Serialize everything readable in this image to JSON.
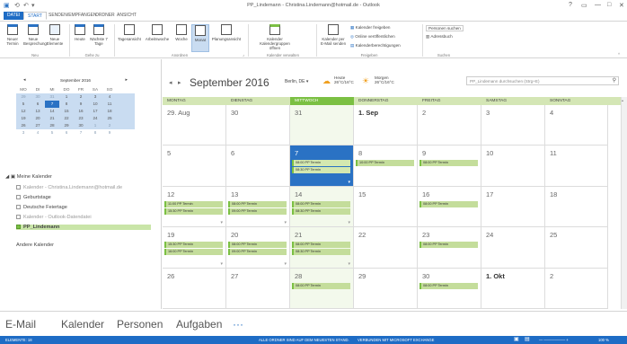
{
  "window": {
    "title": "PP_Lindemann - Christina.Lindemann@hotmail.de - Outlook",
    "help": "?",
    "minimize": "—",
    "maximize": "□",
    "close": "✕"
  },
  "ribbon_tabs": [
    "DATEI",
    "START",
    "SENDEN/EMPFANGEN",
    "ORDNER",
    "ANSICHT"
  ],
  "ribbon": {
    "new": {
      "neuer_termin": "Neuer Termin",
      "neue_besprechung": "Neue Besprechung",
      "neue_elemente": "Neue Elemente",
      "group": "Neu"
    },
    "goto": {
      "heute": "Heute",
      "naechste": "Nächste 7 Tage",
      "group": "Gehe zu"
    },
    "arrange": {
      "tagesansicht": "Tagesansicht",
      "arbeitswoche": "Arbeitswoche",
      "woche": "Woche",
      "monat": "Monat",
      "planung": "Planungsansicht",
      "group": "Anordnen"
    },
    "manage": {
      "kalendergruppen": "Kalender Kalendergruppen",
      "oeffnen": "öffnen",
      "group": "Kalender verwalten"
    },
    "share": {
      "email": "Kalender per E-Mail senden",
      "freigeben": "Kalender freigeben",
      "online": "Online veröffentlichen",
      "berechtigungen": "Kalenderberechtigungen",
      "group": "Freigeben"
    },
    "search": {
      "personen": "Personen suchen",
      "adressbuch": "Adressbuch",
      "group": "Suchen"
    }
  },
  "minical": {
    "title": "September 2016",
    "days": [
      "MO",
      "DI",
      "MI",
      "DO",
      "FR",
      "SA",
      "SO"
    ],
    "weeks": [
      [
        "29",
        "30",
        "31",
        "1",
        "2",
        "3",
        "4"
      ],
      [
        "5",
        "6",
        "7",
        "8",
        "9",
        "10",
        "11"
      ],
      [
        "12",
        "13",
        "14",
        "15",
        "16",
        "17",
        "18"
      ],
      [
        "19",
        "20",
        "21",
        "22",
        "23",
        "24",
        "25"
      ],
      [
        "26",
        "27",
        "28",
        "29",
        "30",
        "1",
        "2"
      ],
      [
        "3",
        "4",
        "5",
        "6",
        "7",
        "8",
        "9"
      ]
    ]
  },
  "calendars": {
    "group_title": "Meine Kalender",
    "items": [
      {
        "label": "Kalender - Christina.Lindemann@hotmail.de",
        "checked": false,
        "grey": true
      },
      {
        "label": "Geburtstage",
        "checked": false,
        "grey": false
      },
      {
        "label": "Deutsche Feiertage",
        "checked": false,
        "grey": false
      },
      {
        "label": "Kalender - Outlook-Datendatei",
        "checked": false,
        "grey": true
      },
      {
        "label": "PP_Lindemann",
        "checked": true,
        "grey": false
      }
    ],
    "other_title": "Andere Kalender"
  },
  "calendar": {
    "month_title": "September 2016",
    "weather_city": "Berlin, DE",
    "heute_label": "Heute",
    "heute_temp": "26°C/16°C",
    "morgen_label": "Morgen",
    "morgen_temp": "26°C/16°C",
    "search_placeholder": "PP_Lindemann durchsuchen (Strg+E)",
    "weekdays": [
      "MONTAG",
      "DIENSTAG",
      "MITTWOCH",
      "DONNERSTAG",
      "FREITAG",
      "SAMSTAG",
      "SONNTAG"
    ],
    "weeks": [
      [
        {
          "d": "29. Aug",
          "ev": []
        },
        {
          "d": "30",
          "ev": []
        },
        {
          "d": "31",
          "ev": []
        },
        {
          "d": "1. Sep",
          "bold": true,
          "ev": []
        },
        {
          "d": "2",
          "ev": []
        },
        {
          "d": "3",
          "ev": []
        },
        {
          "d": "4",
          "ev": []
        }
      ],
      [
        {
          "d": "5",
          "ev": []
        },
        {
          "d": "6",
          "ev": []
        },
        {
          "d": "7",
          "sel": true,
          "ev": [
            "08:00 PP Termin",
            "08:30 PP Termin"
          ]
        },
        {
          "d": "8",
          "ev": [
            "10:00 PP Termin"
          ]
        },
        {
          "d": "9",
          "ev": [
            "08:00 PP Termin"
          ]
        },
        {
          "d": "10",
          "ev": []
        },
        {
          "d": "11",
          "ev": []
        }
      ],
      [
        {
          "d": "12",
          "ev": [
            "11:00 PP Termin",
            "15:30 PP Termin"
          ],
          "more": true
        },
        {
          "d": "13",
          "ev": [
            "08:00 PP Termin",
            "09:00 PP Termin"
          ],
          "more": true
        },
        {
          "d": "14",
          "ev": [
            "08:00 PP Termin",
            "08:30 PP Termin"
          ],
          "more": true
        },
        {
          "d": "15",
          "ev": []
        },
        {
          "d": "16",
          "ev": [
            "08:00 PP Termin"
          ]
        },
        {
          "d": "17",
          "ev": []
        },
        {
          "d": "18",
          "ev": []
        }
      ],
      [
        {
          "d": "19",
          "ev": [
            "15:30 PP Termin",
            "16:00 PP Termin"
          ],
          "more": true
        },
        {
          "d": "20",
          "ev": [
            "08:00 PP Termin",
            "09:00 PP Termin"
          ],
          "more": true
        },
        {
          "d": "21",
          "ev": [
            "08:00 PP Termin",
            "08:30 PP Termin"
          ],
          "more": true
        },
        {
          "d": "22",
          "ev": []
        },
        {
          "d": "23",
          "ev": [
            "08:00 PP Termin"
          ]
        },
        {
          "d": "24",
          "ev": []
        },
        {
          "d": "25",
          "ev": []
        }
      ],
      [
        {
          "d": "26",
          "ev": []
        },
        {
          "d": "27",
          "ev": []
        },
        {
          "d": "28",
          "ev": [
            "08:00 PP Termin"
          ]
        },
        {
          "d": "29",
          "ev": []
        },
        {
          "d": "30",
          "ev": [
            "08:00 PP Termin"
          ]
        },
        {
          "d": "1. Okt",
          "bold": true,
          "ev": []
        },
        {
          "d": "2",
          "ev": []
        }
      ]
    ]
  },
  "bottom_nav": [
    "E-Mail",
    "Kalender",
    "Personen",
    "Aufgaben",
    "···"
  ],
  "status": {
    "elements": "ELEMENTE: 18",
    "center": "ALLE ORDNER SIND AUF DEM NEUESTEN STAND.",
    "connection": "VERBUNDEN MIT MICROSOFT EXCHANGE",
    "zoom": "100 %"
  },
  "colors": {
    "accent": "#1e6cc5",
    "event_green": "#7bc043",
    "event_fill": "#c4dd9b",
    "header_green": "#d4e6b5"
  }
}
